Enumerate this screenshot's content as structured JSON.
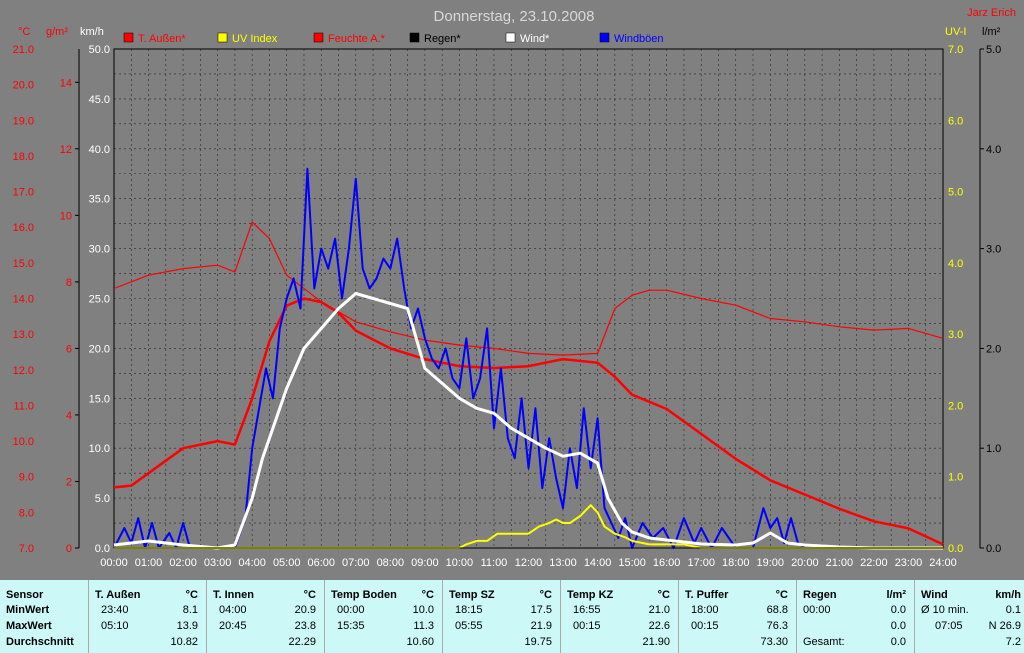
{
  "chart_data": {
    "type": "line",
    "title": "Donnerstag, 23.10.2008",
    "author": "Jarz Erich",
    "x_ticks": [
      "00:00",
      "01:00",
      "02:00",
      "03:00",
      "04:00",
      "05:00",
      "06:00",
      "07:00",
      "08:00",
      "09:00",
      "10:00",
      "11:00",
      "12:00",
      "13:00",
      "14:00",
      "15:00",
      "16:00",
      "17:00",
      "18:00",
      "19:00",
      "20:00",
      "21:00",
      "22:00",
      "23:00",
      "24:00"
    ],
    "axes": {
      "temp": {
        "unit": "°C",
        "ylim": [
          7.0,
          21.0
        ],
        "ticks": [
          "7.0",
          "8.0",
          "9.0",
          "10.0",
          "11.0",
          "12.0",
          "13.0",
          "14.0",
          "15.0",
          "16.0",
          "17.0",
          "18.0",
          "19.0",
          "20.0",
          "21.0"
        ],
        "color": "#ff0000"
      },
      "humidity": {
        "unit": "g/m²",
        "ylim": [
          0,
          15
        ],
        "ticks": [
          "0",
          "2",
          "4",
          "6",
          "8",
          "10",
          "12",
          "14"
        ],
        "color": "#ff0000"
      },
      "wind": {
        "unit": "km/h",
        "ylim": [
          0,
          50
        ],
        "ticks": [
          "0.0",
          "5.0",
          "10.0",
          "15.0",
          "20.0",
          "25.0",
          "30.0",
          "35.0",
          "40.0",
          "45.0",
          "50.0"
        ],
        "color": "#ffffff"
      },
      "uv": {
        "unit": "UV-I",
        "ylim": [
          0,
          7
        ],
        "ticks": [
          "0.0",
          "1.0",
          "2.0",
          "3.0",
          "4.0",
          "5.0",
          "6.0",
          "7.0"
        ],
        "color": "#ffff00"
      },
      "rain": {
        "unit": "l/m²",
        "ylim": [
          0,
          5
        ],
        "ticks": [
          "0.0",
          "1.0",
          "2.0",
          "3.0",
          "4.0",
          "5.0"
        ],
        "color": "#000000"
      }
    },
    "legend": [
      {
        "name": "T. Außen*",
        "color": "#ff0000"
      },
      {
        "name": "UV Index",
        "color": "#ffff00"
      },
      {
        "name": "Feuchte A.*",
        "color": "#ff0000"
      },
      {
        "name": "Regen*",
        "color": "#000000"
      },
      {
        "name": "Wind*",
        "color": "#ffffff"
      },
      {
        "name": "Windböen",
        "color": "#0000ff"
      }
    ],
    "series": [
      {
        "name": "T. Außen*",
        "axis": "temp",
        "color": "#ff0000",
        "x": [
          0,
          0.5,
          1,
          2,
          3,
          3.5,
          4,
          4.5,
          5,
          5.5,
          6,
          6.5,
          7,
          8,
          9,
          10,
          11,
          12,
          13,
          14,
          14.5,
          15,
          16,
          17,
          18,
          19,
          20,
          21,
          22,
          23,
          24
        ],
        "y": [
          8.7,
          8.75,
          9.1,
          9.8,
          10.0,
          9.9,
          11.2,
          12.8,
          13.8,
          14.0,
          13.9,
          13.6,
          13.1,
          12.6,
          12.3,
          12.1,
          12.05,
          12.1,
          12.3,
          12.2,
          11.8,
          11.3,
          10.9,
          10.2,
          9.5,
          8.9,
          8.5,
          8.1,
          7.75,
          7.55,
          7.1
        ]
      },
      {
        "name": "Feuchte A.*",
        "axis": "humidity",
        "color": "#ff0000",
        "x": [
          0,
          1,
          2,
          3,
          3.5,
          4,
          4.5,
          5,
          6,
          7,
          8,
          9,
          10,
          11,
          12,
          13,
          14,
          14.5,
          15,
          15.5,
          16,
          17,
          18,
          19,
          20,
          21,
          22,
          23,
          24
        ],
        "y": [
          7.8,
          8.2,
          8.4,
          8.5,
          8.3,
          9.8,
          9.3,
          8.2,
          7.4,
          6.8,
          6.5,
          6.25,
          6.1,
          6.0,
          5.85,
          5.8,
          5.85,
          7.2,
          7.6,
          7.75,
          7.75,
          7.5,
          7.3,
          6.9,
          6.8,
          6.65,
          6.55,
          6.6,
          6.3
        ]
      },
      {
        "name": "Wind*",
        "axis": "wind",
        "color": "#ffffff",
        "x": [
          0,
          0.5,
          1,
          1.5,
          2,
          3,
          3.5,
          4,
          4.3,
          4.6,
          5,
          5.5,
          6,
          6.5,
          7,
          7.5,
          8,
          8.5,
          9,
          9.5,
          10,
          10.5,
          11,
          11.5,
          12,
          12.5,
          13,
          13.5,
          14,
          14.3,
          14.7,
          15,
          15.5,
          16,
          16.5,
          17,
          18,
          18.5,
          19,
          19.5,
          20,
          20.5,
          21,
          22,
          24
        ],
        "y": [
          0.3,
          0.5,
          0.7,
          0.5,
          0.3,
          0,
          0.3,
          5.0,
          9.0,
          12.0,
          16.0,
          20.0,
          22.0,
          24.0,
          25.5,
          25.0,
          24.5,
          24.0,
          18.0,
          16.5,
          15.0,
          14.0,
          13.5,
          12.0,
          11.0,
          10.0,
          9.2,
          9.5,
          8.5,
          5.0,
          2.5,
          1.6,
          1.0,
          0.8,
          0.6,
          0.4,
          0.3,
          0.5,
          1.5,
          0.5,
          0.3,
          0.2,
          0.1,
          0,
          0
        ]
      },
      {
        "name": "Windböen",
        "axis": "wind",
        "color": "#0000ff",
        "x": [
          0,
          0.3,
          0.5,
          0.7,
          0.9,
          1.1,
          1.3,
          1.6,
          1.8,
          2.0,
          2.2,
          2.5,
          3.0,
          3.5,
          3.8,
          4.0,
          4.2,
          4.4,
          4.6,
          4.8,
          5.0,
          5.2,
          5.4,
          5.6,
          5.8,
          6.0,
          6.2,
          6.4,
          6.6,
          6.8,
          7.0,
          7.2,
          7.4,
          7.6,
          7.8,
          8.0,
          8.2,
          8.4,
          8.6,
          8.8,
          9.0,
          9.2,
          9.4,
          9.6,
          9.8,
          10.0,
          10.2,
          10.4,
          10.6,
          10.8,
          11.0,
          11.2,
          11.4,
          11.6,
          11.8,
          12.0,
          12.2,
          12.4,
          12.6,
          12.8,
          13.0,
          13.2,
          13.4,
          13.6,
          13.8,
          14.0,
          14.2,
          14.4,
          14.6,
          14.8,
          15.0,
          15.3,
          15.6,
          15.9,
          16.2,
          16.5,
          16.8,
          17.0,
          17.3,
          17.6,
          18.0,
          18.5,
          18.8,
          19.0,
          19.2,
          19.4,
          19.6,
          19.8,
          20.0,
          21.0,
          24.0
        ],
        "y": [
          0,
          2.0,
          0.5,
          3.0,
          0,
          2.5,
          0,
          1.5,
          0,
          2.5,
          0,
          0,
          0,
          0,
          3.0,
          10.0,
          14.0,
          18.0,
          15.0,
          22.0,
          25.0,
          27.0,
          24.0,
          38.0,
          26.0,
          30.0,
          28.0,
          31.0,
          25.0,
          30.0,
          37.0,
          28.0,
          26.0,
          27.0,
          29.0,
          28.0,
          31.0,
          26.0,
          22.0,
          24.0,
          21.0,
          19.0,
          18.0,
          20.0,
          17.0,
          16.0,
          21.0,
          15.0,
          17.0,
          22.0,
          12.0,
          18.0,
          11.0,
          9.0,
          15.0,
          8.0,
          14.0,
          6.0,
          11.0,
          7.0,
          4.0,
          10.0,
          6.0,
          14.0,
          8.0,
          13.0,
          4.0,
          2.5,
          1.0,
          3.0,
          0,
          2.5,
          1.0,
          2.0,
          0,
          3.0,
          0.5,
          2.0,
          0,
          2.0,
          0,
          0,
          4.0,
          2.0,
          3.0,
          0.5,
          3.0,
          0.5,
          0,
          0,
          0
        ]
      },
      {
        "name": "UV Index",
        "axis": "uv",
        "color": "#ffff00",
        "x": [
          0,
          10,
          10.2,
          10.5,
          10.8,
          11.1,
          11.5,
          12.0,
          12.3,
          12.6,
          12.8,
          13.0,
          13.2,
          13.5,
          13.8,
          14.0,
          14.2,
          14.5,
          14.8,
          15.0,
          15.5,
          16.0,
          16.5,
          17.0,
          24.0
        ],
        "y": [
          0,
          0,
          0.05,
          0.1,
          0.1,
          0.2,
          0.2,
          0.2,
          0.3,
          0.35,
          0.4,
          0.35,
          0.35,
          0.45,
          0.6,
          0.5,
          0.3,
          0.2,
          0.15,
          0.1,
          0.05,
          0.05,
          0.05,
          0,
          0
        ]
      },
      {
        "name": "Regen*",
        "axis": "rain",
        "color": "#000000",
        "x": [
          0,
          24
        ],
        "y": [
          0,
          0
        ]
      }
    ]
  },
  "stats": {
    "sensor": {
      "title": "Sensor",
      "rows": [
        "MinWert",
        "MaxWert",
        "Durchschnitt"
      ]
    },
    "columns": [
      {
        "title": "T. Außen",
        "unit": "°C",
        "min_time": "23:40",
        "min_val": "8.1",
        "max_time": "05:10",
        "max_val": "13.9",
        "avg": "10.82"
      },
      {
        "title": "T. Innen",
        "unit": "°C",
        "min_time": "04:00",
        "min_val": "20.9",
        "max_time": "20:45",
        "max_val": "23.8",
        "avg": "22.29"
      },
      {
        "title": "Temp Boden",
        "unit": "°C",
        "min_time": "00:00",
        "min_val": "10.0",
        "max_time": "15:35",
        "max_val": "11.3",
        "avg": "10.60"
      },
      {
        "title": "Temp SZ",
        "unit": "°C",
        "min_time": "18:15",
        "min_val": "17.5",
        "max_time": "05:55",
        "max_val": "21.9",
        "avg": "19.75"
      },
      {
        "title": "Temp KZ",
        "unit": "°C",
        "min_time": "16:55",
        "min_val": "21.0",
        "max_time": "00:15",
        "max_val": "22.6",
        "avg": "21.90"
      },
      {
        "title": "T. Puffer",
        "unit": "°C",
        "min_time": "18:00",
        "min_val": "68.8",
        "max_time": "00:15",
        "max_val": "76.3",
        "avg": "73.30"
      }
    ],
    "regen": {
      "title": "Regen",
      "unit": "l/m²",
      "r1_time": "00:00",
      "r1_val": "0.0",
      "r2_val": "0.0",
      "r3_label": "Gesamt:",
      "r3_val": "0.0"
    },
    "wind": {
      "title": "Wind",
      "unit": "km/h",
      "r1_label": "Ø 10 min.",
      "r1_val": "0.1",
      "r2_time": "07:05",
      "r2_val": "N 26.9",
      "r3_val": "7.2"
    }
  }
}
